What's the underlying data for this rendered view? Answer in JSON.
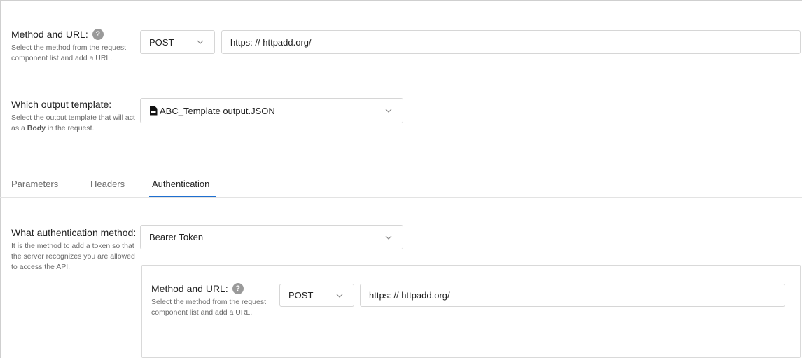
{
  "request": {
    "method_url": {
      "title": "Method and URL:",
      "help": "?",
      "desc": "Select the method from the request component list and add a URL.",
      "method": "POST",
      "url": "https: // httpadd.org/"
    },
    "output_template": {
      "title": "Which output template:",
      "desc_part1": "Select the output template that will act as a ",
      "desc_bold": "Body",
      "desc_part2": " in the request.",
      "selected": "ABC_Template output.JSON"
    }
  },
  "tabs": [
    {
      "label": "Parameters"
    },
    {
      "label": "Headers"
    },
    {
      "label": "Authentication"
    }
  ],
  "auth": {
    "title": "What authentication method:",
    "desc": "It is the method to add a token so that the server recognizes you are allowed to access the API.",
    "selected": "Bearer Token",
    "nested": {
      "title": "Method and URL:",
      "help": "?",
      "desc": "Select the method from the request component list and add a URL.",
      "method": "POST",
      "url": "https: // httpadd.org/"
    }
  },
  "icons": {
    "help": "help-circle-icon",
    "chevron": "chevron-down-icon",
    "file": "file-icon"
  }
}
